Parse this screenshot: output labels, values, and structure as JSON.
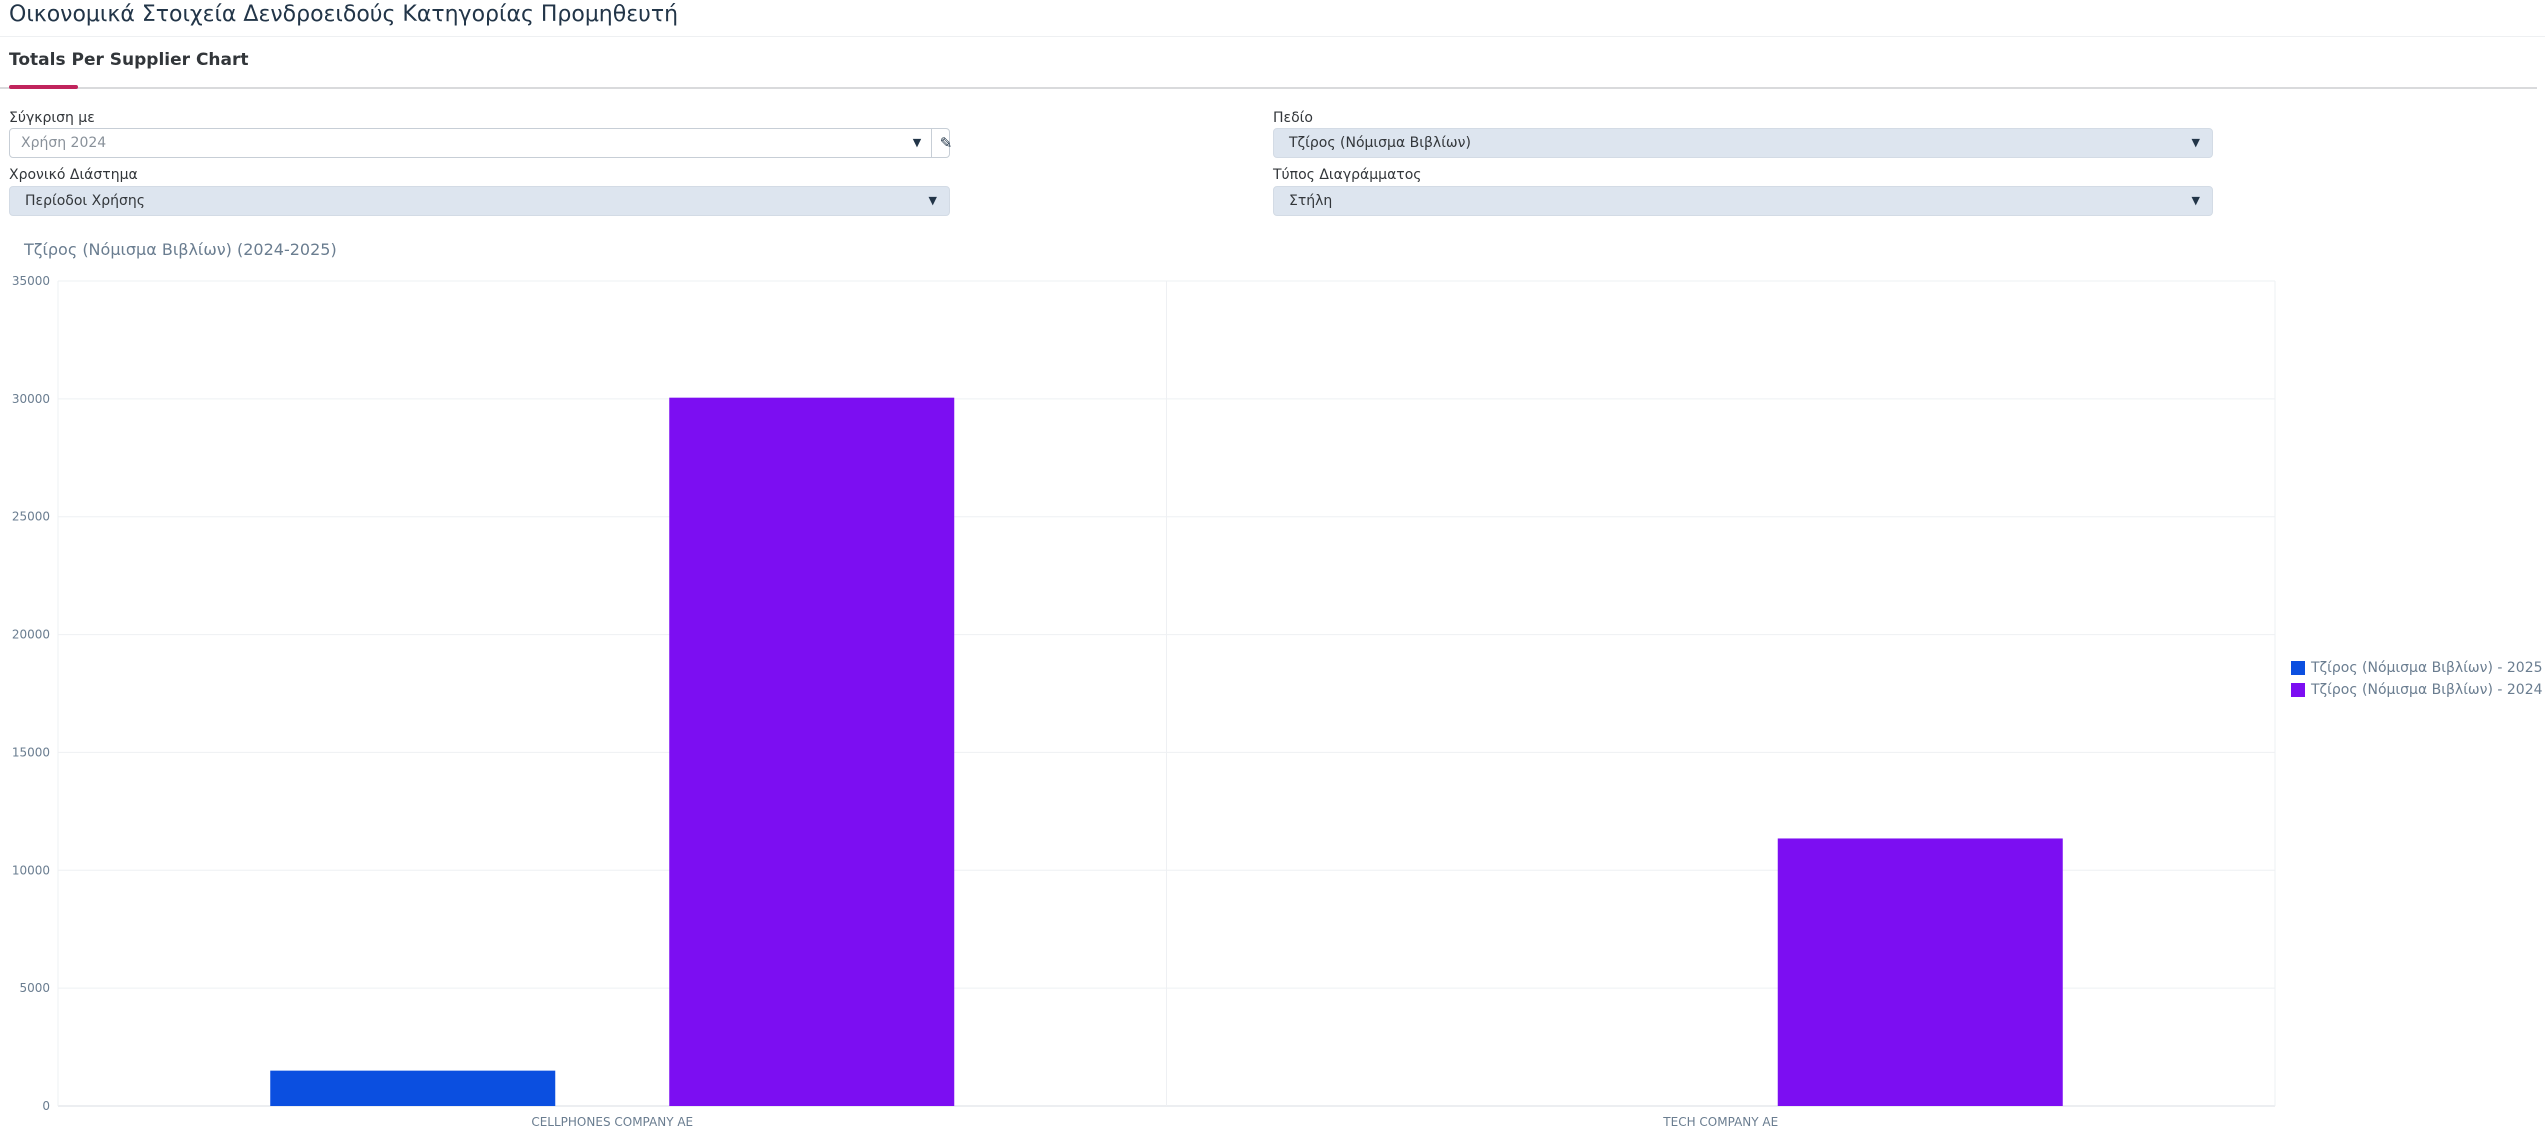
{
  "page": {
    "title": "Οικονομικά Στοιχεία Δενδροειδούς Κατηγορίας Προμηθευτή"
  },
  "tabs": [
    {
      "label": "Totals Per Supplier Chart",
      "selected": true
    }
  ],
  "filters": {
    "compare": {
      "label": "Σύγκριση με",
      "value": "Χρήση 2024"
    },
    "field": {
      "label": "Πεδίο",
      "value": "Τζίρος (Νόμισμα Βιβλίων)"
    },
    "period": {
      "label": "Χρονικό Διάστημα",
      "value": "Περίοδοι Χρήσης"
    },
    "chart_type": {
      "label": "Τύπος Διαγράμματος",
      "value": "Στήλη"
    }
  },
  "icons": {
    "dropdown": "chevron-down-icon",
    "edit": "pencil-icon"
  },
  "chart_data": {
    "type": "bar",
    "title": "Τζίρος (Νόμισμα Βιβλίων) (2024-2025)",
    "categories": [
      "CELLPHONES COMPANY AE",
      "TECH COMPANY AE"
    ],
    "series": [
      {
        "name": "Τζίρος (Νόμισμα Βιβλίων) - 2025",
        "color": "#0b4fe0",
        "values": [
          1500,
          0
        ]
      },
      {
        "name": "Τζίρος (Νόμισμα Βιβλίων) - 2024",
        "color": "#7c0ef2",
        "values": [
          30050,
          11350
        ]
      }
    ],
    "ylim": [
      0,
      35000
    ],
    "yticks": [
      0,
      5000,
      10000,
      15000,
      20000,
      25000,
      30000,
      35000
    ],
    "grid": true,
    "legend": "right"
  }
}
